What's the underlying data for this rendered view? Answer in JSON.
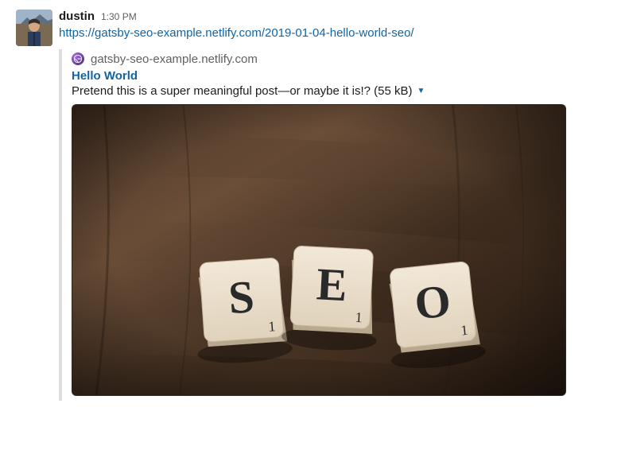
{
  "message": {
    "sender": "dustin",
    "timestamp": "1:30 PM",
    "link_text": "https://gatsby-seo-example.netlify.com/2019-01-04-hello-world-seo/",
    "link_href": "https://gatsby-seo-example.netlify.com/2019-01-04-hello-world-seo/"
  },
  "attachment": {
    "site_name": "gatsby-seo-example.netlify.com",
    "favicon_name": "gatsby-icon",
    "title": "Hello World",
    "description": "Pretend this is a super meaningful post—or maybe it is!? (55 kB)",
    "image_alt": "Scrabble tiles spelling SEO on wooden table",
    "tiles": [
      "S",
      "E",
      "O"
    ]
  }
}
